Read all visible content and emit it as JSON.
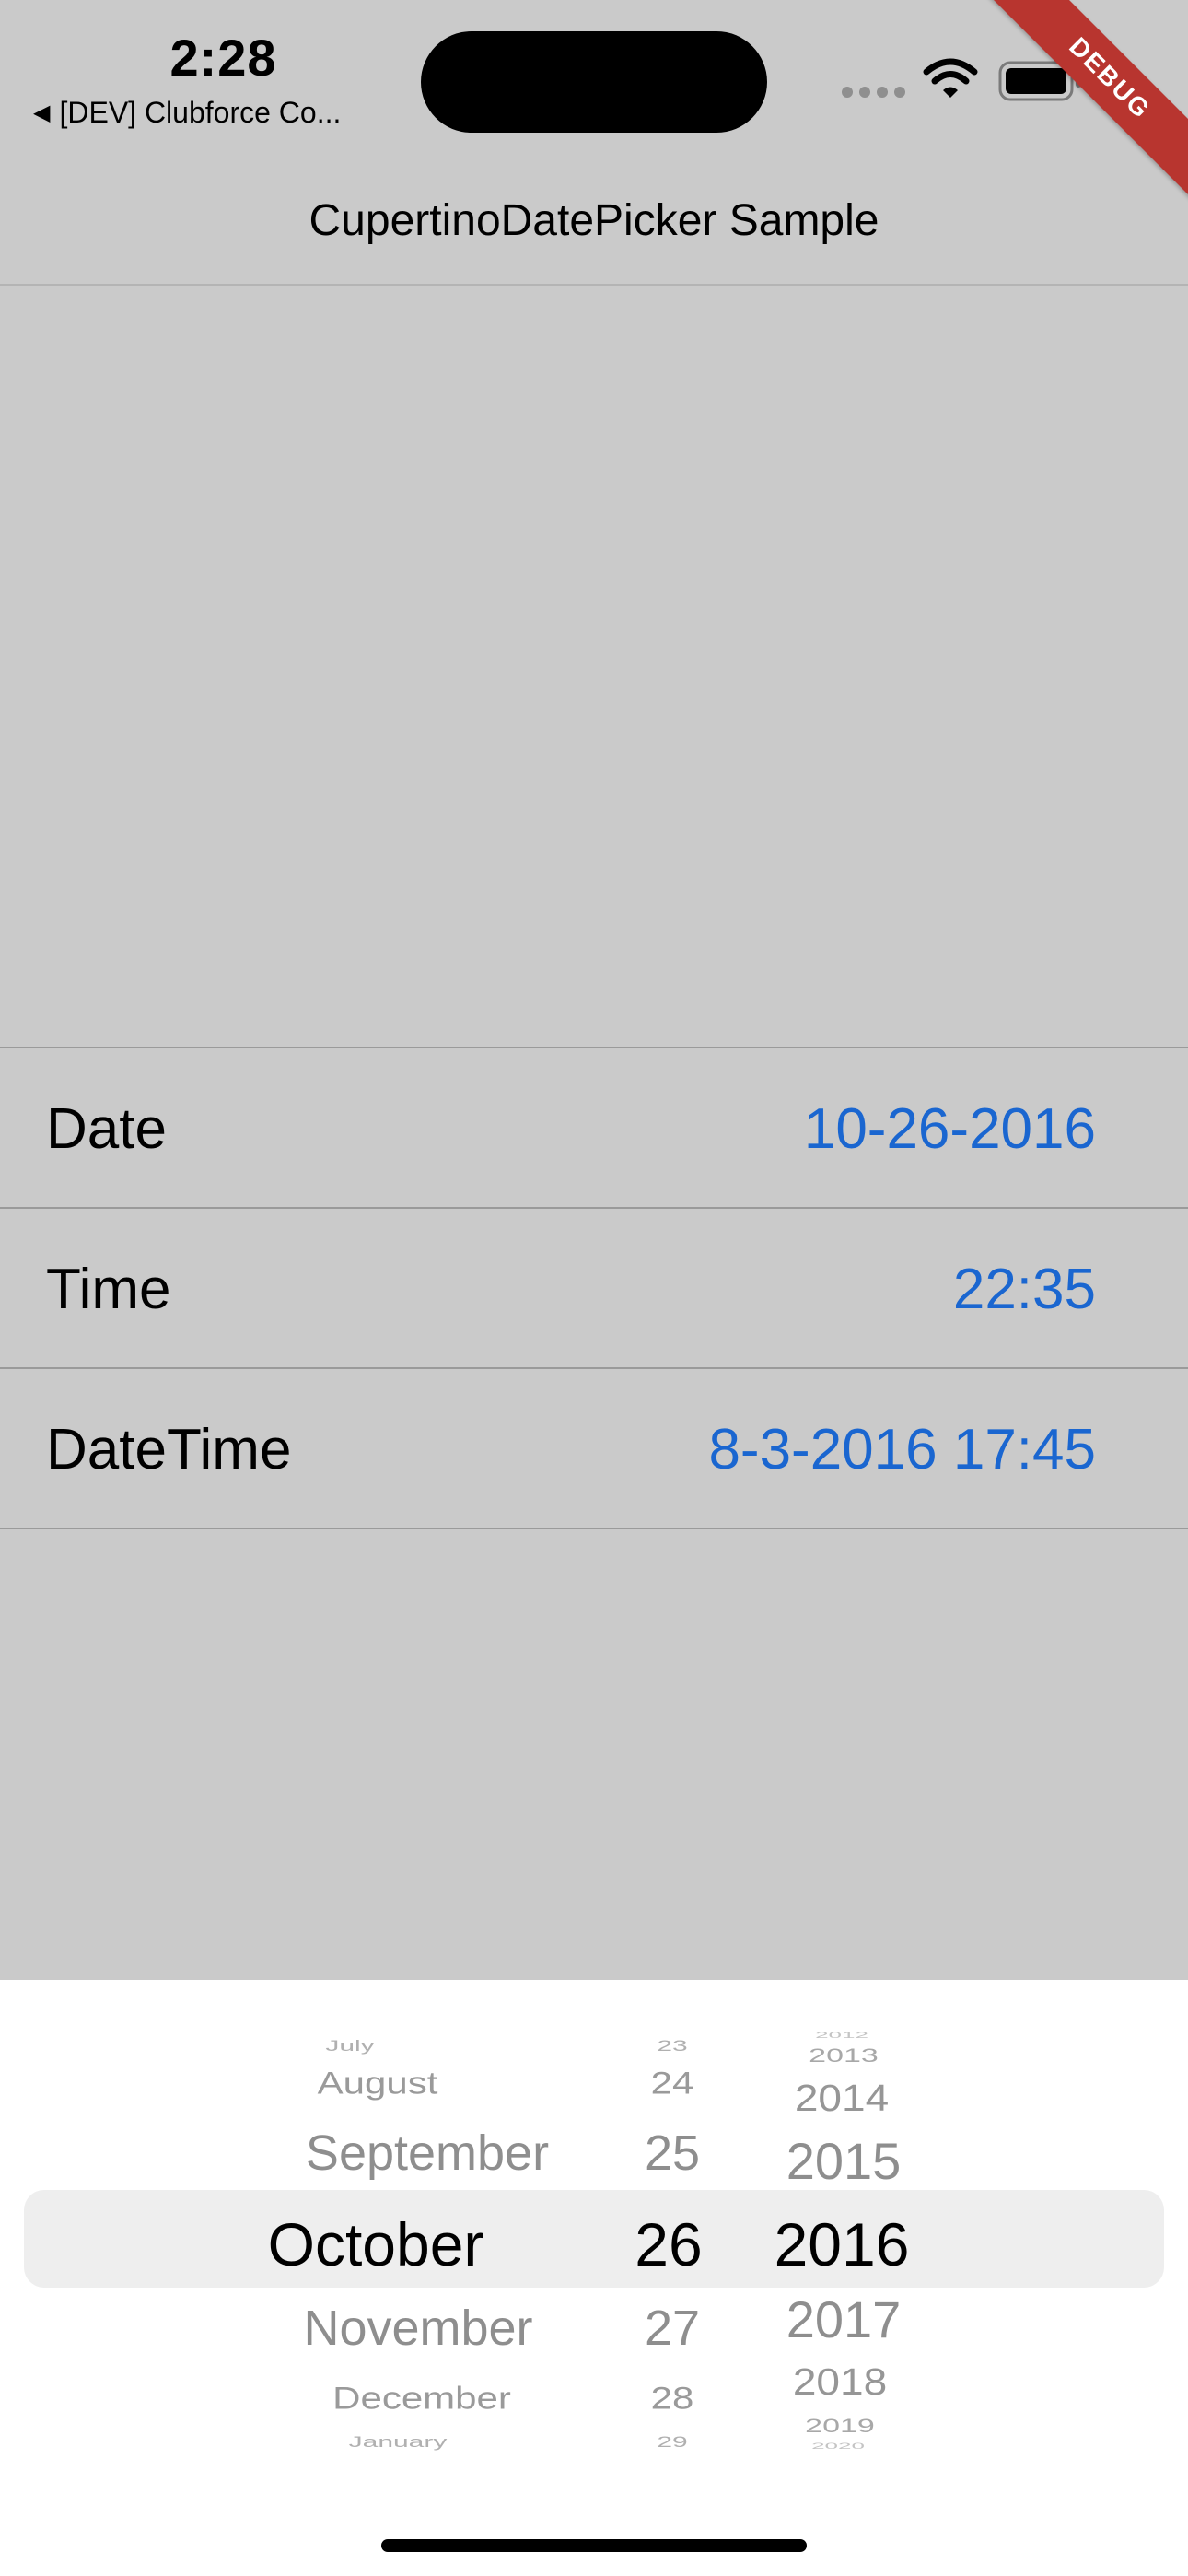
{
  "status_bar": {
    "time": "2:28",
    "back_app": "[DEV] Clubforce Co...",
    "back_icon": "back-triangle-icon",
    "wifi_icon": "wifi-icon",
    "battery_icon": "battery-icon",
    "signal_icon": "cellular-signal-icon"
  },
  "debug_banner": "DEBUG",
  "nav": {
    "title": "CupertinoDatePicker Sample"
  },
  "rows": [
    {
      "label": "Date",
      "value": "10-26-2016"
    },
    {
      "label": "Time",
      "value": "22:35"
    },
    {
      "label": "DateTime",
      "value": "8-3-2016 17:45"
    }
  ],
  "picker": {
    "months": [
      "July",
      "August",
      "September",
      "October",
      "November",
      "December",
      "January"
    ],
    "days": [
      "23",
      "24",
      "25",
      "26",
      "27",
      "28",
      "29"
    ],
    "years": [
      "2012",
      "2013",
      "2014",
      "2015",
      "2016",
      "2017",
      "2018",
      "2019",
      "2020"
    ],
    "selected": {
      "month": "October",
      "day": "26",
      "year": "2016"
    }
  },
  "colors": {
    "background": "#cacaca",
    "value_text": "#1a66d0",
    "debug_banner": "#b8352f",
    "picker_background": "#ffffff",
    "picker_selection": "#eeeeee"
  }
}
